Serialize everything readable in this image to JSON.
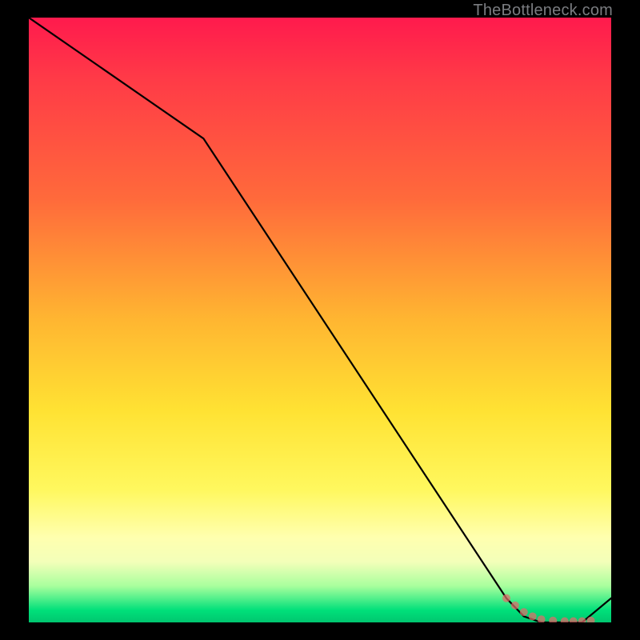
{
  "watermark": "TheBottleneck.com",
  "chart_data": {
    "type": "line",
    "title": "",
    "xlabel": "",
    "ylabel": "",
    "xlim": [
      0,
      100
    ],
    "ylim": [
      0,
      100
    ],
    "series": [
      {
        "name": "curve",
        "x": [
          0,
          30,
          82,
          85,
          88,
          90,
          92,
          95,
          100
        ],
        "values": [
          100,
          80,
          4,
          1,
          0,
          0,
          0,
          0,
          4
        ]
      }
    ],
    "markers": {
      "name": "highlight-cluster",
      "x": [
        82,
        83.5,
        85,
        86.5,
        88,
        90,
        92,
        93.5,
        95,
        96.5
      ],
      "values": [
        4,
        2.8,
        1.7,
        1,
        0.5,
        0.3,
        0.2,
        0.2,
        0.2,
        0.3
      ]
    },
    "background_gradient": {
      "stops": [
        {
          "pos": 0,
          "color": "#ff1a4d"
        },
        {
          "pos": 30,
          "color": "#ff6a3b"
        },
        {
          "pos": 50,
          "color": "#ffb631"
        },
        {
          "pos": 78,
          "color": "#fff85e"
        },
        {
          "pos": 90,
          "color": "#f3ffb9"
        },
        {
          "pos": 98,
          "color": "#00e07a"
        },
        {
          "pos": 100,
          "color": "#00c66f"
        }
      ]
    }
  }
}
